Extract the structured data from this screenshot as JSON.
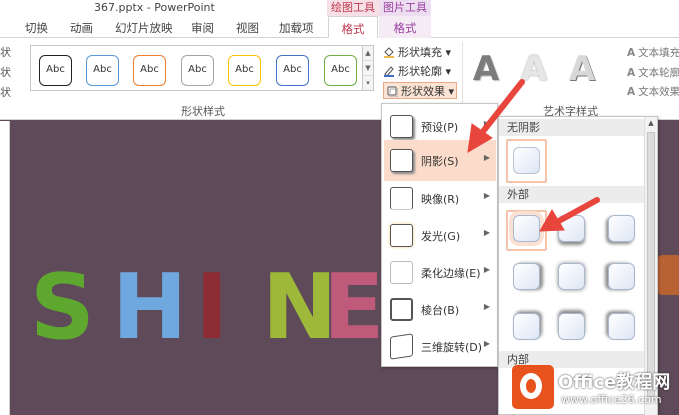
{
  "window": {
    "title": "367.pptx - PowerPoint"
  },
  "context_tabs": {
    "drawing_tools": "绘图工具",
    "picture_tools": "图片工具"
  },
  "tabs": [
    "切换",
    "动画",
    "幻灯片放映",
    "审阅",
    "视图",
    "加载项",
    "格式",
    "格式"
  ],
  "ribbon": {
    "left_stubs": [
      "状",
      "状",
      "状"
    ],
    "shape_styles": [
      "Abc",
      "Abc",
      "Abc",
      "Abc",
      "Abc",
      "Abc",
      "Abc"
    ],
    "shape_styles_colors": [
      "#222222",
      "#5b9bd5",
      "#ed7d31",
      "#a5a5a5",
      "#ffc000",
      "#4472c4",
      "#70ad47"
    ],
    "shape_styles_label": "形状样式",
    "shape_fill": "形状填充",
    "shape_outline": "形状轮廓",
    "shape_effects": "形状效果",
    "wordart_letters": [
      "A",
      "A",
      "A"
    ],
    "wordart_label": "艺术字样式",
    "text_fill": "文本填充",
    "text_outline": "文本轮廓",
    "text_effects": "文本效果"
  },
  "slide": {
    "letters": [
      "S",
      "H",
      "I",
      "N",
      "E"
    ]
  },
  "menu": {
    "items": [
      {
        "label": "预设(P)",
        "has_submenu": true
      },
      {
        "label": "阴影(S)",
        "has_submenu": true,
        "active": true
      },
      {
        "label": "映像(R)",
        "has_submenu": true
      },
      {
        "label": "发光(G)",
        "has_submenu": true
      },
      {
        "label": "柔化边缘(E)",
        "has_submenu": true
      },
      {
        "label": "棱台(B)",
        "has_submenu": true
      },
      {
        "label": "三维旋转(D)",
        "has_submenu": true
      }
    ]
  },
  "submenu": {
    "sections": [
      "无阴影",
      "外部",
      "内部"
    ],
    "outer_presets": [
      "外部右下斜偏移",
      "外部向下偏移",
      "外部左下斜偏移",
      "外部向右偏移",
      "外部居中偏移",
      "外部向左偏移",
      "外部右上斜偏移",
      "外部向上偏移",
      "外部左上斜偏移"
    ]
  },
  "watermark": {
    "name": "Office教程网",
    "url": "www.office26.com"
  },
  "colors": {
    "accent": "#c0394f",
    "highlight": "#fbdcca",
    "arrow": "#e8453c",
    "slide_bg": "#5e4a58"
  }
}
